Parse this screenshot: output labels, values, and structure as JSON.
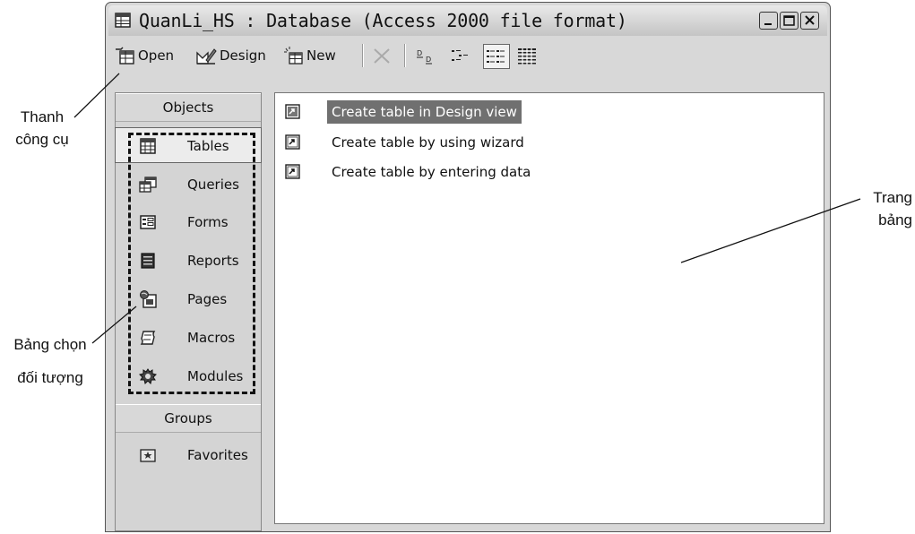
{
  "window": {
    "title": "QuanLi_HS : Database (Access 2000 file format)"
  },
  "toolbar": {
    "open_label": "Open",
    "design_label": "Design",
    "new_label": "New"
  },
  "objects_pane": {
    "header": "Objects",
    "items": [
      {
        "label": "Tables",
        "icon": "table-icon"
      },
      {
        "label": "Queries",
        "icon": "query-icon"
      },
      {
        "label": "Forms",
        "icon": "form-icon"
      },
      {
        "label": "Reports",
        "icon": "report-icon"
      },
      {
        "label": "Pages",
        "icon": "page-icon"
      },
      {
        "label": "Macros",
        "icon": "macro-icon"
      },
      {
        "label": "Modules",
        "icon": "module-icon"
      }
    ],
    "selected": "Tables",
    "groups_header": "Groups",
    "groups": [
      {
        "label": "Favorites",
        "icon": "favorites-icon"
      }
    ]
  },
  "list_pane": {
    "items": [
      {
        "label": "Create table in Design view",
        "selected": true
      },
      {
        "label": "Create table by using wizard",
        "selected": false
      },
      {
        "label": "Create table by entering data",
        "selected": false
      }
    ]
  },
  "annotations": {
    "toolbar_line1": "Thanh",
    "toolbar_line2": "công cụ",
    "objects_line1": "Bảng chọn",
    "objects_line2": "đối tượng",
    "page_line1": "Trang",
    "page_line2": "bảng"
  }
}
